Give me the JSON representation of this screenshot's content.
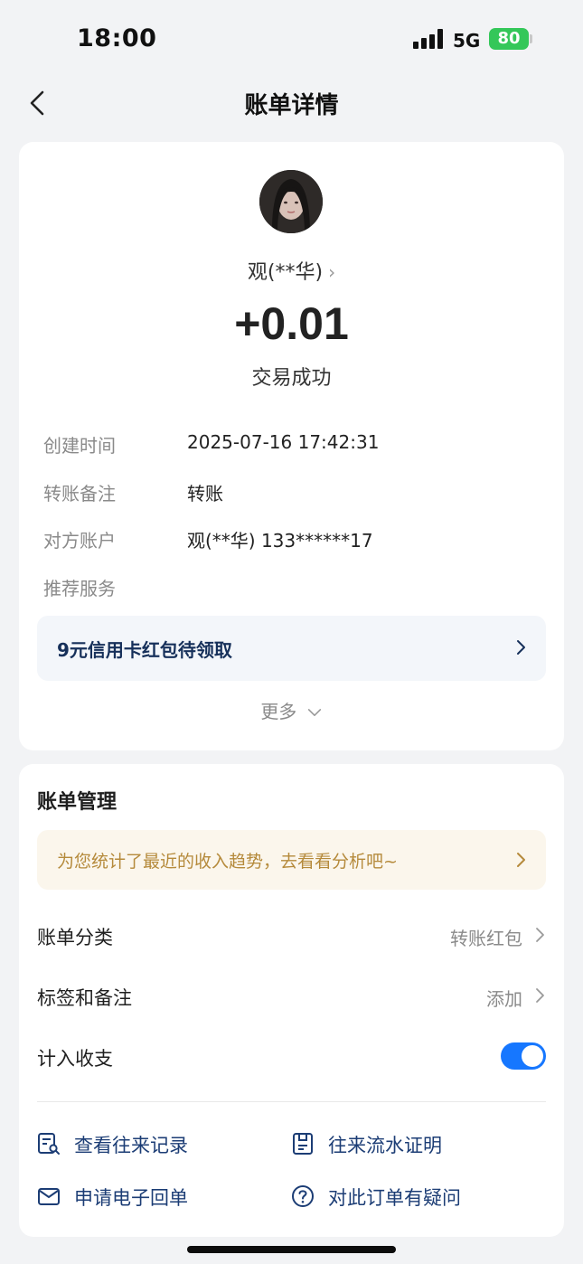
{
  "status_bar": {
    "time": "18:00",
    "network": "5G",
    "battery": "80"
  },
  "nav": {
    "title": "账单详情"
  },
  "summary": {
    "payee": "观(**华)",
    "amount": "+0.01",
    "status": "交易成功"
  },
  "details": [
    {
      "label": "创建时间",
      "value": "2025-07-16 17:42:31"
    },
    {
      "label": "转账备注",
      "value": "转账"
    },
    {
      "label": "对方账户",
      "value": "观(**华) 133******17"
    },
    {
      "label": "推荐服务",
      "value": ""
    }
  ],
  "promo": {
    "text": "9元信用卡红包待领取"
  },
  "more": {
    "label": "更多"
  },
  "manage": {
    "title": "账单管理",
    "tip": "为您统计了最近的收入趋势，去看看分析吧~",
    "category": {
      "label": "账单分类",
      "value": "转账红包"
    },
    "tags": {
      "label": "标签和备注",
      "value": "添加"
    },
    "count": {
      "label": "计入收支",
      "enabled": true
    }
  },
  "actions": {
    "history": "查看往来记录",
    "statement": "往来流水证明",
    "receipt": "申请电子回单",
    "question": "对此订单有疑问"
  },
  "colors": {
    "accent": "#1677ff",
    "link": "#1c3d75",
    "tip": "#b58a3b"
  }
}
